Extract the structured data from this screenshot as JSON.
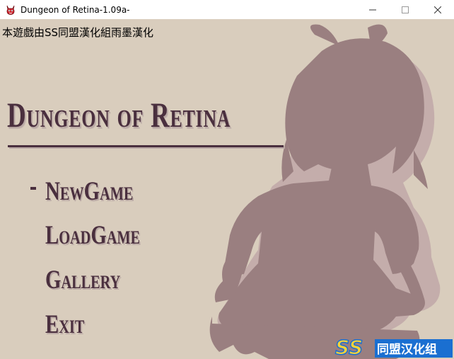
{
  "window": {
    "title": "Dungeon of Retina-1.09a-",
    "minimize_glyph": "—",
    "maximize_glyph": "☐",
    "close_glyph": "✕"
  },
  "game": {
    "credit": "本遊戲由SS同盟漢化組雨墨漢化",
    "title": "Dungeon of Retina",
    "menu": {
      "new_game": "NewGame",
      "load_game": "LoadGame",
      "gallery": "Gallery",
      "exit": "Exit"
    },
    "selected_item": "new_game",
    "watermark_text": "SS同盟汉化组"
  },
  "colors": {
    "background": "#d9cdbd",
    "silhouette": "#9a7f80",
    "silhouette_shadow": "#c4adab",
    "text_dark": "#4a2f3e",
    "watermark_yellow": "#f5d23a",
    "watermark_blue": "#1a6fd1"
  },
  "icons": {
    "app_icon": "red-demon-face-icon",
    "minimize": "minimize-icon",
    "maximize": "maximize-icon",
    "close": "close-icon"
  }
}
